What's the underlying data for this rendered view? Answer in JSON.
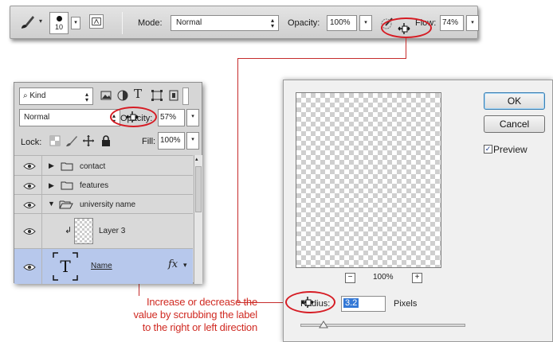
{
  "options_bar": {
    "brush_size": "10",
    "mode_label": "Mode:",
    "mode_value": "Normal",
    "opacity_label": "Opacity:",
    "opacity_value": "100%",
    "flow_label": "Flow:",
    "flow_value": "74%"
  },
  "layers_panel": {
    "filter_kind": "Kind",
    "filter_icons": [
      "image-icon",
      "adjustment-icon",
      "type-icon",
      "shape-icon",
      "smart-object-icon"
    ],
    "blend_mode": "Normal",
    "opacity_label": "Opacity:",
    "opacity_value": "57%",
    "lock_label": "Lock:",
    "fill_label": "Fill:",
    "fill_value": "100%",
    "layers": [
      {
        "name": "contact",
        "kind": "group-collapsed"
      },
      {
        "name": "features",
        "kind": "group-collapsed"
      },
      {
        "name": "university name",
        "kind": "group-expanded"
      },
      {
        "name": "Layer 3",
        "kind": "pixel-clipped"
      },
      {
        "name": "Name",
        "kind": "type",
        "selected": true,
        "fx": "fx"
      }
    ]
  },
  "dialog": {
    "zoom_out": "−",
    "zoom_level": "100%",
    "zoom_in": "+",
    "ok_label": "OK",
    "cancel_label": "Cancel",
    "preview_label": "Preview",
    "preview_checked": true,
    "radius_label": "Radius:",
    "radius_value": "3.2",
    "units_label": "Pixels"
  },
  "annotation": {
    "caption_lines": [
      "Increase or decrease the",
      "value by scrubbing the label",
      "to the right or left direction"
    ],
    "accent_color": "#d02a22"
  }
}
